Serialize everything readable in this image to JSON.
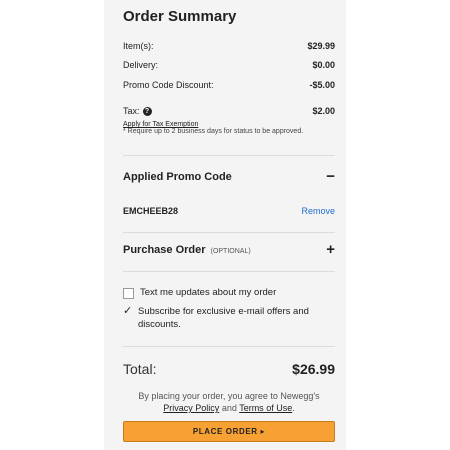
{
  "summary": {
    "title": "Order Summary",
    "items_label": "Item(s):",
    "items_value": "$29.99",
    "delivery_label": "Delivery:",
    "delivery_value": "$0.00",
    "discount_label": "Promo Code Discount:",
    "discount_value": "-$5.00",
    "tax_label": "Tax:",
    "tax_value": "$2.00",
    "tax_help_icon": "question-circle-icon",
    "tax_exemption_link": "Apply for Tax Exemption",
    "tax_note": "* Require up to 2 business days for status to be approved."
  },
  "promo": {
    "heading": "Applied Promo Code",
    "toggle_icon": "minus-icon",
    "code": "EMCHEEB28",
    "remove_label": "Remove"
  },
  "purchase_order": {
    "heading": "Purchase Order",
    "optional_label": "(OPTIONAL)",
    "toggle_icon": "plus-icon"
  },
  "options": {
    "text_updates_label": "Text me updates about my order",
    "text_updates_checked": false,
    "subscribe_label": "Subscribe for exclusive e-mail offers and discounts.",
    "subscribe_checked": true
  },
  "total": {
    "label": "Total:",
    "value": "$26.99"
  },
  "agreement": {
    "prefix": "By placing your order, you agree to Newegg's",
    "privacy_link": "Privacy Policy",
    "and": "and",
    "terms_link": "Terms of Use",
    "suffix": "."
  },
  "place_order": {
    "label": "PLACE ORDER ▸",
    "color": "#f7a134"
  }
}
